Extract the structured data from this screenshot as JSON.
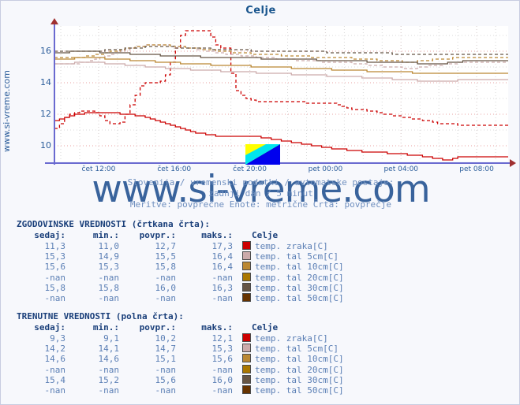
{
  "title": "Celje",
  "side_url": "www.si-vreme.com",
  "watermark": "www.si-vreme.com",
  "caption": {
    "line1": "Slovenija / vremenski podatki / avtomatske postaje:",
    "line2": "zadnji dan / 5 minut",
    "line3": "Meritve: povprečne  Enote: metrične  Črta: povprečje"
  },
  "chart_data": {
    "type": "line",
    "title": "Celje",
    "xlabel": "",
    "ylabel": "",
    "ylim": [
      9.0,
      17.6
    ],
    "yticks": [
      10,
      12,
      14,
      16
    ],
    "xticks": [
      "čet 12:00",
      "čet 16:00",
      "čet 20:00",
      "pet 00:00",
      "pet 04:00",
      "pet 08:00"
    ],
    "grid": true,
    "legend": "inline-table",
    "series": [
      {
        "name": "temp. zraka[C] (zgodovinske)",
        "style": "dashed",
        "color": "#cc0000",
        "sedaj": 11.3,
        "min": 11.0,
        "povpr": 12.7,
        "maks": 17.3,
        "values": [
          11.1,
          11.4,
          11.8,
          12.0,
          12.1,
          12.2,
          12.2,
          12.2,
          12.1,
          11.9,
          11.6,
          11.4,
          11.4,
          11.5,
          12.0,
          12.6,
          13.2,
          13.8,
          14.0,
          14.0,
          14.0,
          14.1,
          14.5,
          15.3,
          16.2,
          17.0,
          17.3,
          17.3,
          17.3,
          17.3,
          17.3,
          16.9,
          16.4,
          16.2,
          16.2,
          14.6,
          13.5,
          13.2,
          13.0,
          12.9,
          12.8,
          12.8,
          12.8,
          12.8,
          12.8,
          12.8,
          12.8,
          12.8,
          12.8,
          12.8,
          12.7,
          12.7,
          12.7,
          12.7,
          12.7,
          12.7,
          12.6,
          12.5,
          12.4,
          12.3,
          12.3,
          12.3,
          12.2,
          12.2,
          12.1,
          12.0,
          12.0,
          11.9,
          11.9,
          11.8,
          11.8,
          11.7,
          11.7,
          11.6,
          11.6,
          11.5,
          11.4,
          11.4,
          11.4,
          11.4,
          11.3,
          11.3,
          11.3,
          11.3,
          11.3,
          11.3,
          11.3,
          11.3,
          11.3,
          11.3
        ]
      },
      {
        "name": "temp. tal  5cm[C] (zgodovinske)",
        "style": "dashed",
        "color": "#ccaaaa",
        "sedaj": 15.3,
        "min": 14.9,
        "povpr": 15.5,
        "maks": 16.4,
        "values": [
          15.2,
          15.2,
          15.2,
          15.2,
          15.2,
          15.3,
          15.3,
          15.4,
          15.5,
          15.6,
          15.7,
          15.8,
          15.9,
          16.0,
          16.1,
          16.2,
          16.3,
          16.3,
          16.4,
          16.4,
          16.4,
          16.4,
          16.4,
          16.3,
          16.3,
          16.3,
          16.2,
          16.2,
          16.1,
          16.1,
          16.0,
          16.0,
          15.9,
          15.9,
          15.8,
          15.8,
          15.8,
          15.7,
          15.7,
          15.7,
          15.6,
          15.6,
          15.6,
          15.6,
          15.5,
          15.5,
          15.5,
          15.5,
          15.4,
          15.4,
          15.4,
          15.4,
          15.4,
          15.3,
          15.3,
          15.3,
          15.3,
          15.3,
          15.3,
          15.2,
          15.2,
          15.2,
          15.1,
          15.1,
          15.1,
          15.0,
          15.0,
          15.0,
          15.0,
          14.9,
          14.9,
          14.9,
          15.0,
          15.0,
          15.1,
          15.1,
          15.1,
          15.2,
          15.2,
          15.2,
          15.3,
          15.3,
          15.3,
          15.3,
          15.3,
          15.3,
          15.3,
          15.3,
          15.3,
          15.3
        ]
      },
      {
        "name": "temp. tal 10cm[C] (zgodovinske)",
        "style": "dashed",
        "color": "#bb8833",
        "sedaj": 15.6,
        "min": 15.3,
        "povpr": 15.8,
        "maks": 16.4,
        "values": [
          15.6,
          15.6,
          15.6,
          15.6,
          15.6,
          15.6,
          15.7,
          15.7,
          15.8,
          15.8,
          15.9,
          16.0,
          16.0,
          16.1,
          16.2,
          16.2,
          16.3,
          16.3,
          16.4,
          16.4,
          16.4,
          16.4,
          16.4,
          16.3,
          16.3,
          16.3,
          16.2,
          16.2,
          16.2,
          16.1,
          16.1,
          16.1,
          16.0,
          16.0,
          16.0,
          15.9,
          15.9,
          15.9,
          15.9,
          15.8,
          15.8,
          15.8,
          15.8,
          15.8,
          15.8,
          15.7,
          15.7,
          15.7,
          15.7,
          15.7,
          15.7,
          15.6,
          15.6,
          15.6,
          15.6,
          15.6,
          15.6,
          15.6,
          15.6,
          15.5,
          15.5,
          15.5,
          15.5,
          15.5,
          15.4,
          15.4,
          15.4,
          15.4,
          15.4,
          15.3,
          15.3,
          15.3,
          15.4,
          15.4,
          15.4,
          15.5,
          15.5,
          15.5,
          15.5,
          15.6,
          15.6,
          15.6,
          15.6,
          15.6,
          15.6,
          15.6,
          15.6,
          15.6,
          15.6,
          15.6
        ]
      },
      {
        "name": "temp. tal 20cm[C] (zgodovinske)",
        "style": "dashed",
        "color": "#aa7700",
        "sedaj": "-nan",
        "min": "-nan",
        "povpr": "-nan",
        "maks": "-nan",
        "values": []
      },
      {
        "name": "temp. tal 30cm[C] (zgodovinske)",
        "style": "dashed",
        "color": "#665544",
        "sedaj": 15.8,
        "min": 15.8,
        "povpr": 16.0,
        "maks": 16.3,
        "values": [
          16.0,
          16.0,
          16.0,
          16.0,
          16.0,
          16.0,
          16.0,
          16.0,
          16.0,
          16.0,
          16.1,
          16.1,
          16.1,
          16.1,
          16.2,
          16.2,
          16.2,
          16.2,
          16.3,
          16.3,
          16.3,
          16.3,
          16.3,
          16.3,
          16.2,
          16.2,
          16.2,
          16.2,
          16.2,
          16.2,
          16.2,
          16.1,
          16.1,
          16.1,
          16.1,
          16.1,
          16.1,
          16.1,
          16.1,
          16.0,
          16.0,
          16.0,
          16.0,
          16.0,
          16.0,
          16.0,
          16.0,
          16.0,
          16.0,
          16.0,
          16.0,
          16.0,
          16.0,
          16.0,
          15.9,
          15.9,
          15.9,
          15.9,
          15.9,
          15.9,
          15.9,
          15.9,
          15.9,
          15.9,
          15.9,
          15.9,
          15.9,
          15.8,
          15.8,
          15.8,
          15.8,
          15.8,
          15.8,
          15.8,
          15.8,
          15.8,
          15.8,
          15.8,
          15.8,
          15.8,
          15.8,
          15.8,
          15.8,
          15.8,
          15.8,
          15.8,
          15.8,
          15.8,
          15.8,
          15.8
        ]
      },
      {
        "name": "temp. tal 50cm[C] (zgodovinske)",
        "style": "dashed",
        "color": "#663300",
        "sedaj": "-nan",
        "min": "-nan",
        "povpr": "-nan",
        "maks": "-nan",
        "values": []
      },
      {
        "name": "temp. zraka[C] (trenutne)",
        "style": "solid",
        "color": "#cc0000",
        "sedaj": 9.3,
        "min": 9.1,
        "povpr": 10.2,
        "maks": 12.1,
        "values": [
          11.6,
          11.7,
          11.8,
          11.9,
          12.0,
          12.0,
          12.1,
          12.1,
          12.1,
          12.1,
          12.1,
          12.1,
          12.1,
          12.0,
          12.0,
          12.0,
          11.9,
          11.9,
          11.8,
          11.7,
          11.6,
          11.5,
          11.4,
          11.3,
          11.2,
          11.1,
          11.0,
          10.9,
          10.8,
          10.8,
          10.7,
          10.7,
          10.6,
          10.6,
          10.6,
          10.6,
          10.6,
          10.6,
          10.6,
          10.6,
          10.6,
          10.5,
          10.5,
          10.4,
          10.4,
          10.3,
          10.3,
          10.2,
          10.2,
          10.1,
          10.1,
          10.0,
          10.0,
          9.9,
          9.9,
          9.8,
          9.8,
          9.8,
          9.7,
          9.7,
          9.7,
          9.6,
          9.6,
          9.6,
          9.6,
          9.6,
          9.5,
          9.5,
          9.5,
          9.5,
          9.4,
          9.4,
          9.4,
          9.3,
          9.3,
          9.2,
          9.2,
          9.1,
          9.1,
          9.2,
          9.3,
          9.3,
          9.3,
          9.3,
          9.3,
          9.3,
          9.3,
          9.3,
          9.3,
          9.3
        ]
      },
      {
        "name": "temp. tal  5cm[C] (trenutne)",
        "style": "solid",
        "color": "#ccaaaa",
        "sedaj": 14.2,
        "min": 14.1,
        "povpr": 14.7,
        "maks": 15.3,
        "values": [
          15.2,
          15.2,
          15.2,
          15.2,
          15.3,
          15.3,
          15.3,
          15.3,
          15.3,
          15.3,
          15.2,
          15.2,
          15.2,
          15.2,
          15.1,
          15.1,
          15.1,
          15.1,
          15.0,
          15.0,
          15.0,
          15.0,
          14.9,
          14.9,
          14.9,
          14.9,
          14.9,
          14.8,
          14.8,
          14.8,
          14.8,
          14.8,
          14.8,
          14.7,
          14.7,
          14.7,
          14.7,
          14.7,
          14.7,
          14.7,
          14.6,
          14.6,
          14.6,
          14.6,
          14.6,
          14.6,
          14.6,
          14.5,
          14.5,
          14.5,
          14.5,
          14.5,
          14.5,
          14.5,
          14.4,
          14.4,
          14.4,
          14.4,
          14.4,
          14.4,
          14.4,
          14.3,
          14.3,
          14.3,
          14.3,
          14.3,
          14.3,
          14.2,
          14.2,
          14.2,
          14.2,
          14.2,
          14.1,
          14.1,
          14.1,
          14.1,
          14.1,
          14.1,
          14.1,
          14.1,
          14.2,
          14.2,
          14.2,
          14.2,
          14.2,
          14.2,
          14.2,
          14.2,
          14.2,
          14.2
        ]
      },
      {
        "name": "temp. tal 10cm[C] (trenutne)",
        "style": "solid",
        "color": "#bb8833",
        "sedaj": 14.6,
        "min": 14.6,
        "povpr": 15.1,
        "maks": 15.6,
        "values": [
          15.5,
          15.5,
          15.5,
          15.5,
          15.6,
          15.6,
          15.6,
          15.6,
          15.6,
          15.6,
          15.5,
          15.5,
          15.5,
          15.5,
          15.5,
          15.4,
          15.4,
          15.4,
          15.4,
          15.4,
          15.3,
          15.3,
          15.3,
          15.3,
          15.3,
          15.2,
          15.2,
          15.2,
          15.2,
          15.2,
          15.2,
          15.1,
          15.1,
          15.1,
          15.1,
          15.1,
          15.1,
          15.1,
          15.1,
          15.0,
          15.0,
          15.0,
          15.0,
          15.0,
          15.0,
          15.0,
          15.0,
          14.9,
          14.9,
          14.9,
          14.9,
          14.9,
          14.9,
          14.9,
          14.9,
          14.8,
          14.8,
          14.8,
          14.8,
          14.8,
          14.8,
          14.8,
          14.7,
          14.7,
          14.7,
          14.7,
          14.7,
          14.7,
          14.7,
          14.7,
          14.7,
          14.6,
          14.6,
          14.6,
          14.6,
          14.6,
          14.6,
          14.6,
          14.6,
          14.6,
          14.6,
          14.6,
          14.6,
          14.6,
          14.6,
          14.6,
          14.6,
          14.6,
          14.6,
          14.6
        ]
      },
      {
        "name": "temp. tal 20cm[C] (trenutne)",
        "style": "solid",
        "color": "#aa7700",
        "sedaj": "-nan",
        "min": "-nan",
        "povpr": "-nan",
        "maks": "-nan",
        "values": []
      },
      {
        "name": "temp. tal 30cm[C] (trenutne)",
        "style": "solid",
        "color": "#665544",
        "sedaj": 15.4,
        "min": 15.2,
        "povpr": 15.6,
        "maks": 16.0,
        "values": [
          15.9,
          15.9,
          15.9,
          16.0,
          16.0,
          16.0,
          16.0,
          16.0,
          16.0,
          15.9,
          15.9,
          15.9,
          15.9,
          15.9,
          15.9,
          15.8,
          15.8,
          15.8,
          15.8,
          15.8,
          15.8,
          15.7,
          15.7,
          15.7,
          15.7,
          15.7,
          15.7,
          15.7,
          15.7,
          15.6,
          15.6,
          15.6,
          15.6,
          15.6,
          15.6,
          15.6,
          15.6,
          15.6,
          15.6,
          15.6,
          15.6,
          15.5,
          15.5,
          15.5,
          15.5,
          15.5,
          15.5,
          15.5,
          15.5,
          15.5,
          15.5,
          15.5,
          15.4,
          15.4,
          15.4,
          15.4,
          15.4,
          15.4,
          15.4,
          15.4,
          15.4,
          15.4,
          15.3,
          15.3,
          15.3,
          15.3,
          15.3,
          15.3,
          15.3,
          15.3,
          15.3,
          15.3,
          15.2,
          15.2,
          15.2,
          15.2,
          15.2,
          15.2,
          15.3,
          15.3,
          15.3,
          15.4,
          15.4,
          15.4,
          15.4,
          15.4,
          15.4,
          15.4,
          15.4,
          15.4
        ]
      },
      {
        "name": "temp. tal 50cm[C] (trenutne)",
        "style": "solid",
        "color": "#663300",
        "sedaj": "-nan",
        "min": "-nan",
        "povpr": "-nan",
        "maks": "-nan",
        "values": []
      }
    ]
  },
  "tables": [
    {
      "heading": "ZGODOVINSKE VREDNOSTI (črtkana črta):",
      "columns": [
        "sedaj:",
        "min.:",
        "povpr.:",
        "maks.:",
        "Celje"
      ],
      "rows": [
        {
          "sedaj": "11,3",
          "min": "11,0",
          "povpr": "12,7",
          "maks": "17,3",
          "color": "#cc0000",
          "label": "temp. zraka[C]"
        },
        {
          "sedaj": "15,3",
          "min": "14,9",
          "povpr": "15,5",
          "maks": "16,4",
          "color": "#ccaaaa",
          "label": "temp. tal  5cm[C]"
        },
        {
          "sedaj": "15,6",
          "min": "15,3",
          "povpr": "15,8",
          "maks": "16,4",
          "color": "#bb8833",
          "label": "temp. tal 10cm[C]"
        },
        {
          "sedaj": "-nan",
          "min": "-nan",
          "povpr": "-nan",
          "maks": "-nan",
          "color": "#aa7700",
          "label": "temp. tal 20cm[C]"
        },
        {
          "sedaj": "15,8",
          "min": "15,8",
          "povpr": "16,0",
          "maks": "16,3",
          "color": "#665544",
          "label": "temp. tal 30cm[C]"
        },
        {
          "sedaj": "-nan",
          "min": "-nan",
          "povpr": "-nan",
          "maks": "-nan",
          "color": "#663300",
          "label": "temp. tal 50cm[C]"
        }
      ]
    },
    {
      "heading": "TRENUTNE VREDNOSTI (polna črta):",
      "columns": [
        "sedaj:",
        "min.:",
        "povpr.:",
        "maks.:",
        "Celje"
      ],
      "rows": [
        {
          "sedaj": "9,3",
          "min": "9,1",
          "povpr": "10,2",
          "maks": "12,1",
          "color": "#cc0000",
          "label": "temp. zraka[C]"
        },
        {
          "sedaj": "14,2",
          "min": "14,1",
          "povpr": "14,7",
          "maks": "15,3",
          "color": "#ccaaaa",
          "label": "temp. tal  5cm[C]"
        },
        {
          "sedaj": "14,6",
          "min": "14,6",
          "povpr": "15,1",
          "maks": "15,6",
          "color": "#bb8833",
          "label": "temp. tal 10cm[C]"
        },
        {
          "sedaj": "-nan",
          "min": "-nan",
          "povpr": "-nan",
          "maks": "-nan",
          "color": "#aa7700",
          "label": "temp. tal 20cm[C]"
        },
        {
          "sedaj": "15,4",
          "min": "15,2",
          "povpr": "15,6",
          "maks": "16,0",
          "color": "#665544",
          "label": "temp. tal 30cm[C]"
        },
        {
          "sedaj": "-nan",
          "min": "-nan",
          "povpr": "-nan",
          "maks": "-nan",
          "color": "#663300",
          "label": "temp. tal 50cm[C]"
        }
      ]
    }
  ]
}
